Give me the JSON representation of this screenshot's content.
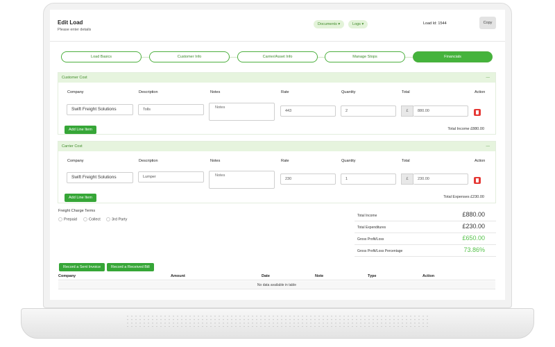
{
  "header": {
    "title": "Edit Load",
    "subtitle": "Please enter details",
    "documents_label": "Documents",
    "logs_label": "Logs",
    "load_id_label": "Load Id: 1544",
    "copy_label": "Copy"
  },
  "steps": [
    "Load Basics",
    "Customer Info",
    "Carrier/Asset Info",
    "Manage Stops",
    "Financials"
  ],
  "active_step": "Financials",
  "columns": {
    "company": "Company",
    "description": "Description",
    "notes": "Notes",
    "rate": "Rate",
    "quantity": "Quantity",
    "total": "Total",
    "action": "Action"
  },
  "customer_cost": {
    "title": "Customer Cost",
    "collapse": "—",
    "company": "Swift Freight Solutions",
    "description": "Tolls",
    "notes_placeholder": "Notes",
    "rate": "443",
    "quantity": "2",
    "currency": "£",
    "total": "880.00",
    "add_line_label": "Add Line Item",
    "summary": "Total Income £880.00"
  },
  "carrier_cost": {
    "title": "Carrier Cost",
    "collapse": "—",
    "company": "Swift Freight Solutions",
    "description": "Lumper",
    "notes_placeholder": "Notes",
    "rate": "230",
    "quantity": "1",
    "currency": "£",
    "total": "230.00",
    "add_line_label": "Add Line Item",
    "summary": "Total Expenses £230.00"
  },
  "freight_terms": {
    "title": "Freight Charge Terms",
    "options": [
      "Prepaid",
      "Collect",
      "3rd Party"
    ]
  },
  "summary": [
    {
      "label": "Total Income",
      "value": "£880.00"
    },
    {
      "label": "Total Expenditures",
      "value": "£230.00"
    },
    {
      "label": "Gross Profit/Loss",
      "value": "£650.00"
    },
    {
      "label": "Gross Profit/Loss Percentage",
      "value": "73.86%"
    }
  ],
  "invoice_buttons": {
    "sent": "Record a Sent Invoice",
    "received": "Record a Received Bill"
  },
  "invoice_table": {
    "headers": [
      "Company",
      "Amount",
      "Date",
      "Note",
      "Type",
      "Action"
    ],
    "empty": "No data available in table"
  },
  "colors": {
    "accent": "#45b33c",
    "accent_light": "#e6f4de",
    "danger": "#e53935"
  }
}
